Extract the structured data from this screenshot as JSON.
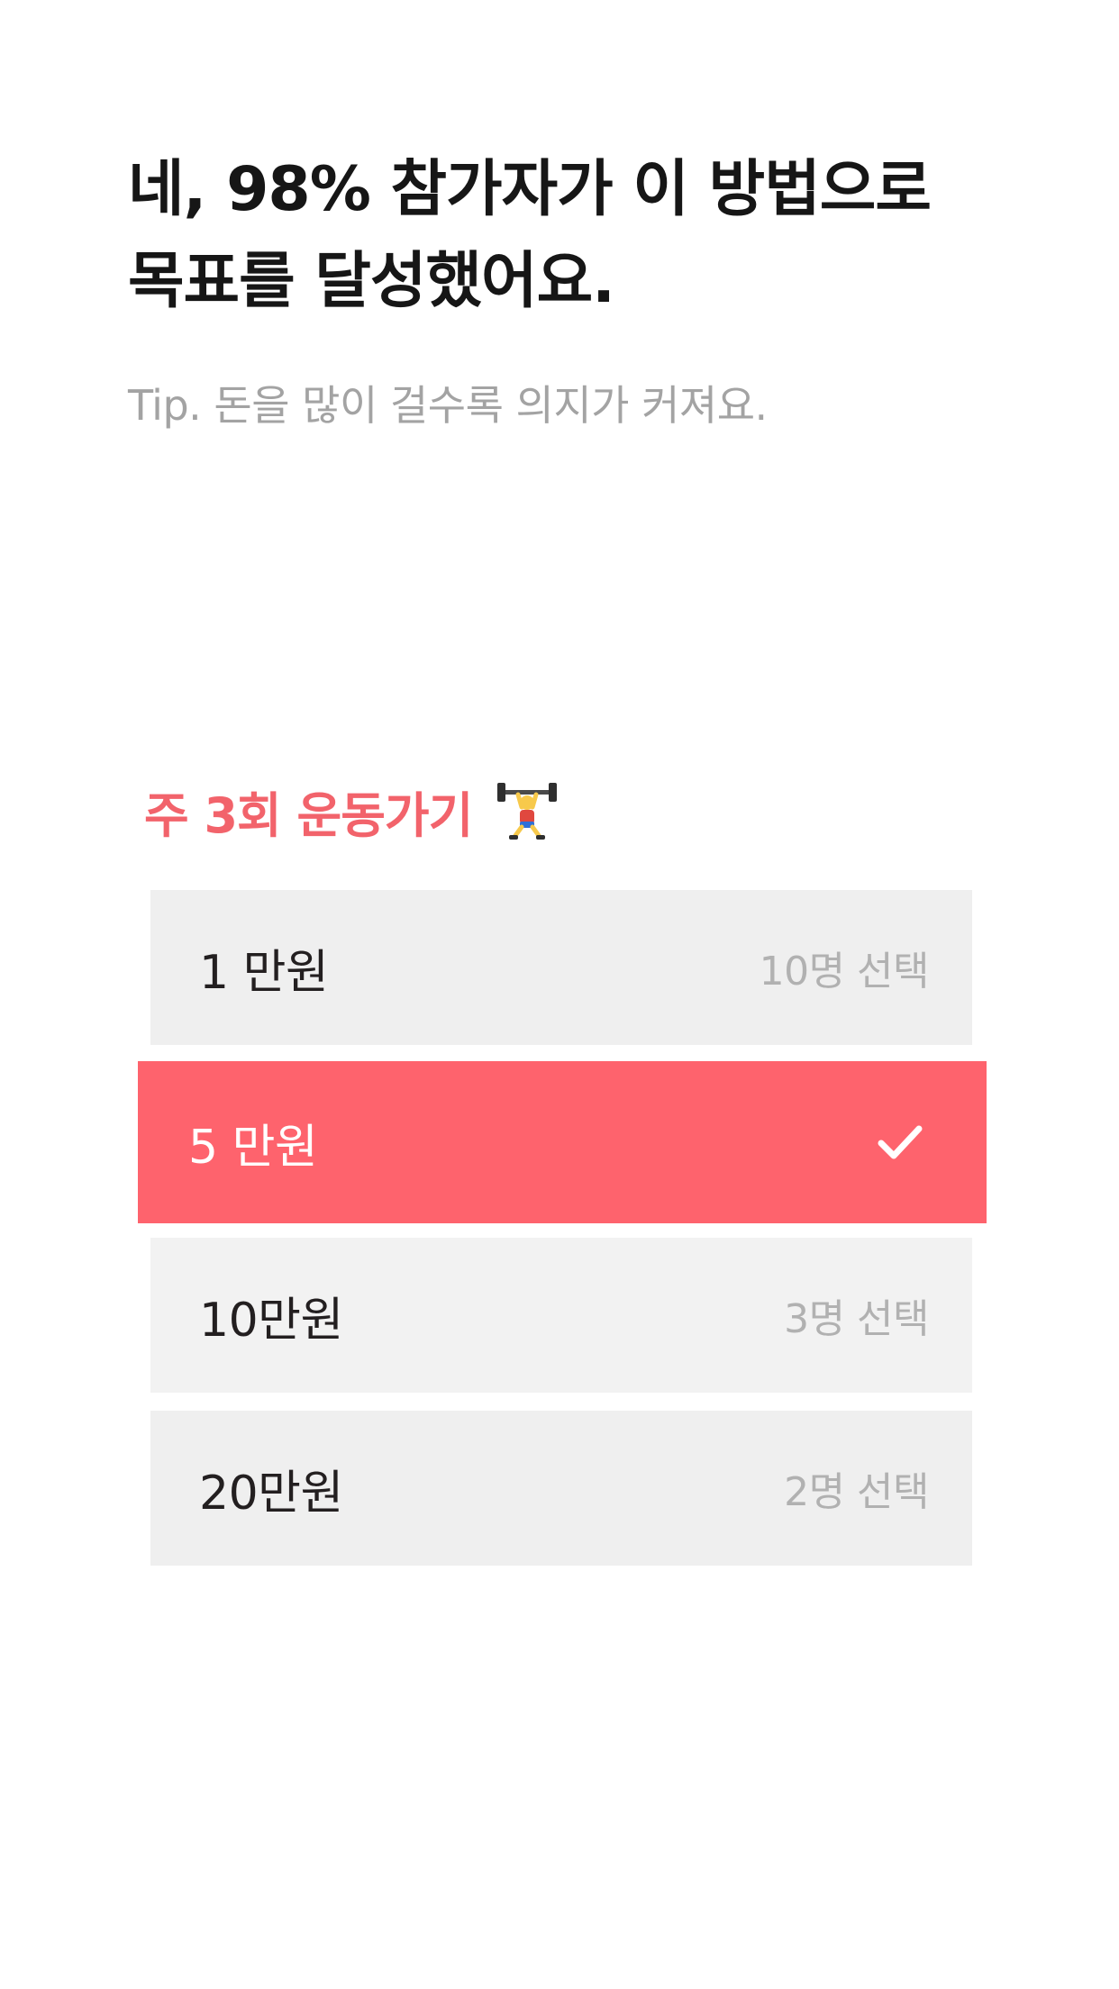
{
  "header": {
    "title_line1": "네, 98% 참가자가 이 방법으로",
    "title_line2": "목표를 달성했어요.",
    "tip": "Tip. 돈을 많이 걸수록 의지가 커져요."
  },
  "goal": {
    "label": "주 3회 운동가기",
    "icon": "weightlifter-icon"
  },
  "options": [
    {
      "label": "1 만원",
      "count": "10명 선택",
      "selected": false
    },
    {
      "label": "5 만원",
      "count": "",
      "selected": true,
      "icon": "check-icon"
    },
    {
      "label": "10만원",
      "count": "3명 선택",
      "selected": false
    },
    {
      "label": "20만원",
      "count": "2명 선택",
      "selected": false
    }
  ],
  "colors": {
    "accent": "#fe636d",
    "goal_text": "#f2636b",
    "option_bg": "#efefef",
    "muted_text": "#a3a3a3"
  }
}
